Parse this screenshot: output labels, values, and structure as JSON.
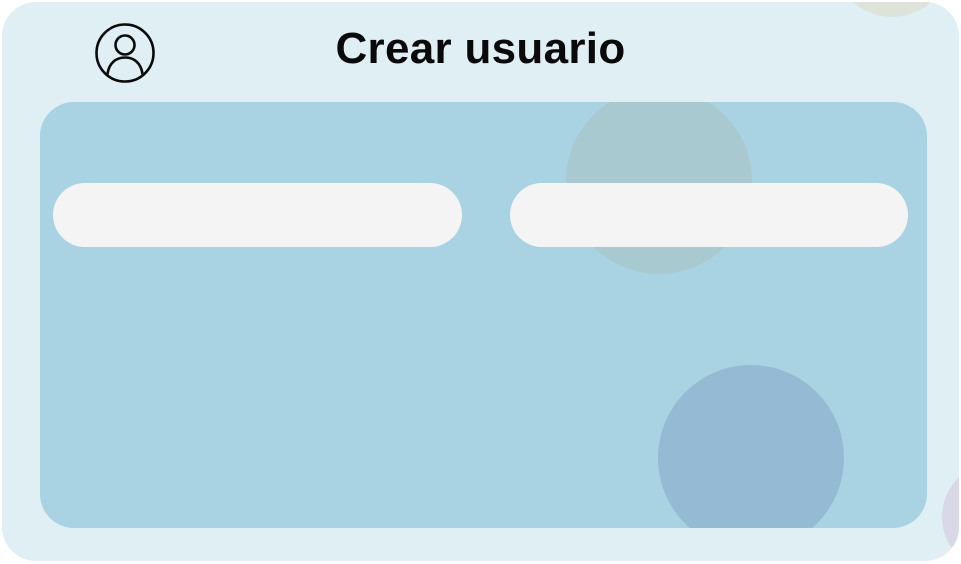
{
  "header": {
    "title": "Crear usuario",
    "icon": "user-avatar-icon"
  },
  "form": {
    "field_left": {
      "value": "",
      "placeholder": ""
    },
    "field_right": {
      "value": "",
      "placeholder": ""
    }
  },
  "colors": {
    "card_background": "#e0eff4",
    "panel_background": "#a9d3e2",
    "field_background": "#f4f4f4",
    "title_color": "#0a0a0a"
  }
}
